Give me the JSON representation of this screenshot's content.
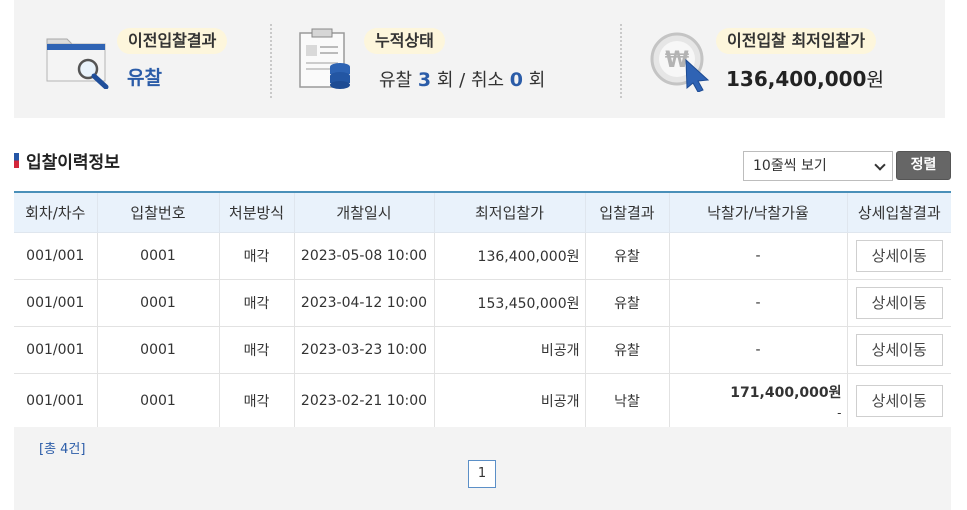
{
  "summary": {
    "prev_result": {
      "label": "이전입찰결과",
      "value": "유찰"
    },
    "cumulative": {
      "label": "누적상태",
      "fail_prefix": "유찰",
      "fail_count": "3",
      "fail_unit": "회",
      "sep": "/",
      "cancel_prefix": "취소",
      "cancel_count": "0",
      "cancel_unit": "회"
    },
    "prev_min_price": {
      "label": "이전입찰 최저입찰가",
      "value": "136,400,000",
      "unit": "원"
    }
  },
  "history": {
    "title": "입찰이력정보",
    "rows_select": "10줄씩 보기",
    "sort_label": "정렬",
    "columns": [
      "회차/차수",
      "입찰번호",
      "처분방식",
      "개찰일시",
      "최저입찰가",
      "입찰결과",
      "낙찰가/낙찰가율",
      "상세입찰결과"
    ],
    "rows": [
      {
        "round": "001/001",
        "bid_no": "0001",
        "method": "매각",
        "open_dt": "2023-05-08 10:00",
        "min_price": "136,400,000원",
        "result": "유찰",
        "win": "-",
        "detail": "상세이동"
      },
      {
        "round": "001/001",
        "bid_no": "0001",
        "method": "매각",
        "open_dt": "2023-04-12 10:00",
        "min_price": "153,450,000원",
        "result": "유찰",
        "win": "-",
        "detail": "상세이동"
      },
      {
        "round": "001/001",
        "bid_no": "0001",
        "method": "매각",
        "open_dt": "2023-03-23 10:00",
        "min_price": "비공개",
        "result": "유찰",
        "win": "-",
        "detail": "상세이동"
      },
      {
        "round": "001/001",
        "bid_no": "0001",
        "method": "매각",
        "open_dt": "2023-02-21 10:00",
        "min_price": "비공개",
        "result": "낙찰",
        "win_price": "171,400,000원",
        "win_rate": "-",
        "detail": "상세이동"
      }
    ],
    "total": "[총 4건]",
    "page": "1"
  },
  "colors": {
    "accent_blue": "#2b5ca8",
    "header_border": "#4a90b9",
    "pill_bg": "#fdf6dc",
    "panel_bg": "#f3f3f3"
  },
  "icons": [
    "folder-search-icon",
    "clipboard-coins-icon",
    "won-coin-cursor-icon",
    "select-chevron-icon"
  ]
}
